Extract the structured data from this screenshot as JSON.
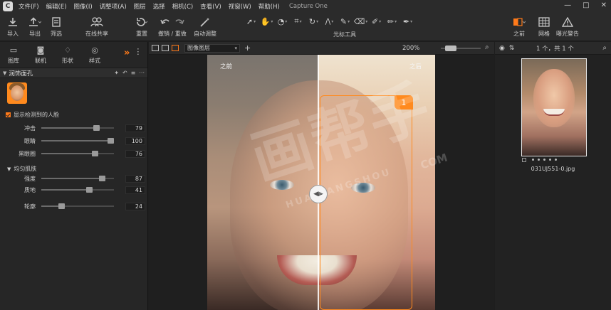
{
  "menu": {
    "logo": "C",
    "items": [
      "文件(F)",
      "编辑(E)",
      "图像(I)",
      "调整项(A)",
      "图层",
      "选择",
      "相机(C)",
      "查看(V)",
      "视窗(W)",
      "帮助(H)"
    ],
    "window_title": "Capture One",
    "controls": {
      "minimize": "—",
      "maximize": "□",
      "close": "✕"
    }
  },
  "toolbar": {
    "import_label": "导入",
    "export_label": "导出",
    "filter_label": "筛选",
    "share_label": "在线共享",
    "reset_label": "重置",
    "undo_redo_label": "撤销 / 重做",
    "auto_label": "自动调整",
    "cursor_tools_label": "光标工具",
    "before_label": "之前",
    "grid_label": "网格",
    "exposure_label": "曝光警告"
  },
  "left_panel": {
    "tabs": [
      {
        "label": "图库",
        "icon": "folder-icon"
      },
      {
        "label": "联机",
        "icon": "camera-icon"
      },
      {
        "label": "形状",
        "icon": "shape-icon"
      },
      {
        "label": "样式",
        "icon": "style-icon"
      }
    ],
    "tool_title": "润饰面孔",
    "show_faces_label": "显示检测到的人脸",
    "sliders_top": [
      {
        "label": "冲击",
        "value": "79",
        "fraction": 0.79
      },
      {
        "label": "眼睛",
        "value": "100",
        "fraction": 1.0
      },
      {
        "label": "黑眼圈",
        "value": "76",
        "fraction": 0.76
      }
    ],
    "even_skin_label": "均匀肌肤",
    "sliders_skin": [
      {
        "label": "强度",
        "value": "87",
        "fraction": 0.87
      },
      {
        "label": "质地",
        "value": "41",
        "fraction": 0.68
      }
    ],
    "slider_contour": {
      "label": "轮廓",
      "value": "24",
      "fraction": 0.26
    }
  },
  "viewer": {
    "layer_select": "图像图层",
    "zoom": "200%",
    "before_label": "之前",
    "after_label": "之后",
    "face_badge": "1"
  },
  "browser": {
    "count": "1 个，共 1 个",
    "filename": "031UJ551-0.jpg"
  },
  "watermark": {
    "main": "画帮手",
    "sub1": "HUA BANGSHOU",
    "sub2": "COM"
  },
  "colors": {
    "accent": "#ff7a1a",
    "panel": "#262626",
    "background": "#1e1e1e"
  }
}
